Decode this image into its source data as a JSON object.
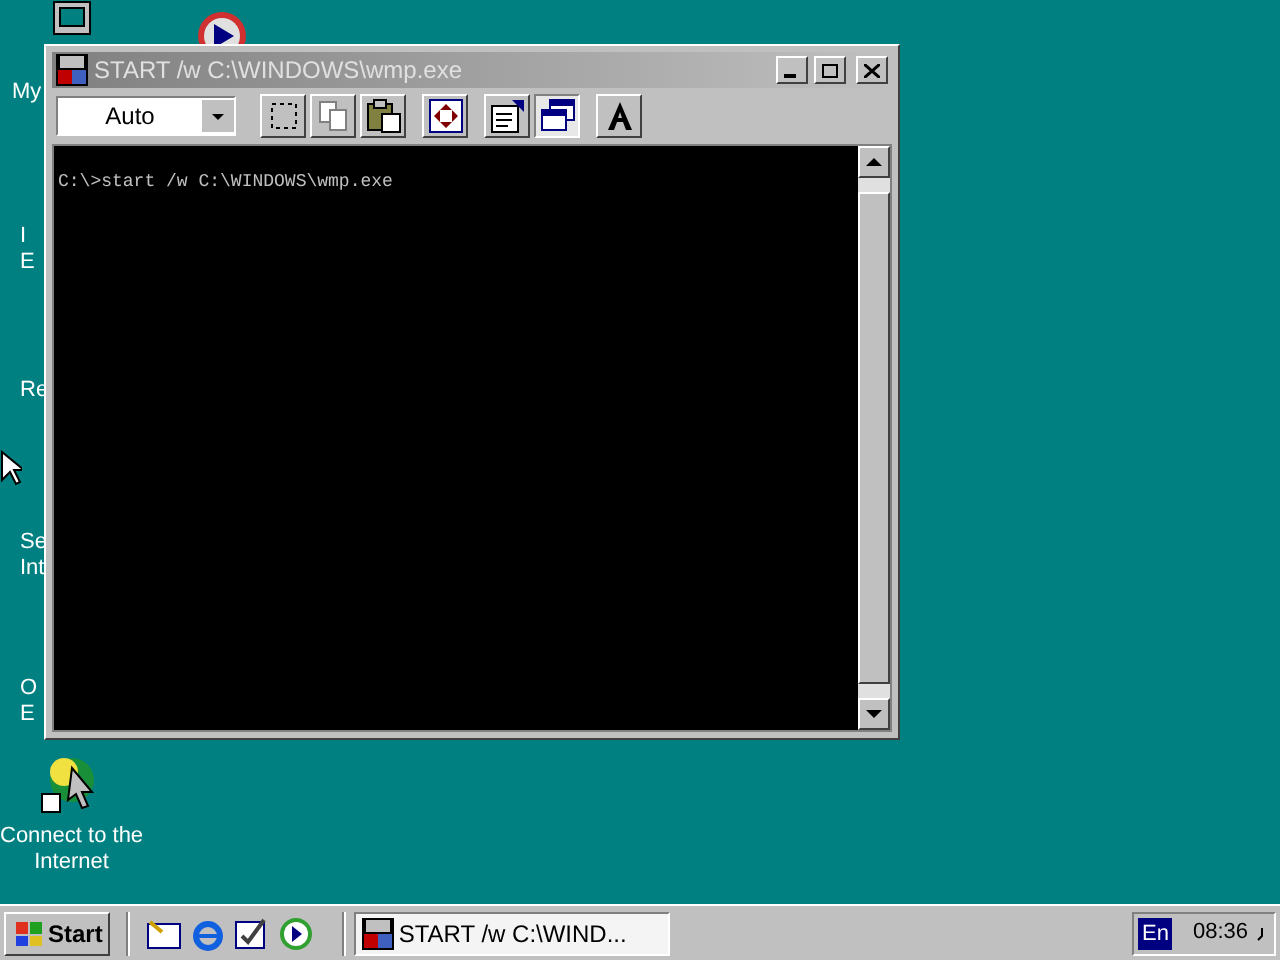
{
  "desktop_icons": [
    {
      "kind": "computer",
      "lines": [
        "My"
      ]
    },
    {
      "kind": "none",
      "lines": [
        "I",
        "E"
      ]
    },
    {
      "kind": "none",
      "lines": [
        "Re"
      ]
    },
    {
      "kind": "none",
      "lines": [
        "Se",
        "Int"
      ]
    },
    {
      "kind": "none",
      "lines": [
        "O",
        "E"
      ]
    },
    {
      "kind": "connect",
      "lines": [
        "Connect to the",
        "Internet"
      ]
    }
  ],
  "window": {
    "title": "START /w C:\\WINDOWS\\wmp.exe",
    "active": false,
    "font_size": "Auto",
    "toolbar_buttons": [
      {
        "kind": "mark",
        "selected": false
      },
      {
        "kind": "copy",
        "selected": false
      },
      {
        "kind": "paste",
        "selected": false
      },
      {
        "kind": "fullscreen",
        "selected": false
      },
      {
        "kind": "properties",
        "selected": false
      },
      {
        "kind": "background",
        "selected": true
      },
      {
        "kind": "font",
        "selected": false
      }
    ],
    "console_lines": [
      "C:\\>start /w C:\\WINDOWS\\wmp.exe"
    ]
  },
  "taskbar": {
    "start": "Start",
    "tasks": [
      {
        "label": "START /w C:\\WIND...",
        "selected": true
      }
    ],
    "language": "En",
    "clock": "08:36"
  }
}
